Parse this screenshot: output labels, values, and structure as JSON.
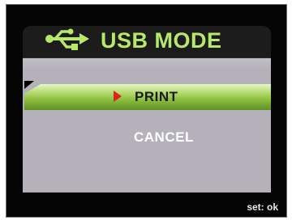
{
  "header": {
    "title": "USB MODE",
    "icon": "usb-icon"
  },
  "menu": {
    "items": [
      {
        "label": "PRINT",
        "selected": true
      },
      {
        "label": "CANCEL",
        "selected": false
      }
    ]
  },
  "footer": {
    "hint": "set: ok"
  },
  "colors": {
    "title_text": "#b8e86a",
    "panel": "#b5b1ba",
    "selection_green": "#8cbf3e",
    "selection_arrow": "#e0201a",
    "background": "#050505"
  }
}
